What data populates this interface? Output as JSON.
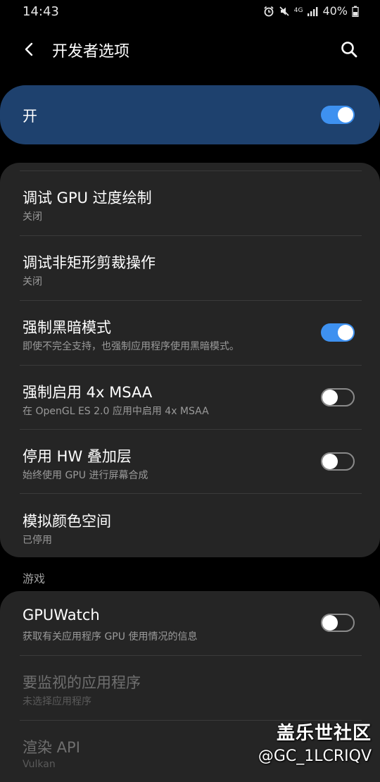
{
  "status_bar": {
    "time": "14:43",
    "network_tag": "4G",
    "battery": "40%"
  },
  "app_bar": {
    "title": "开发者选项",
    "back_icon": "chevron-left-icon",
    "search_icon": "search-icon"
  },
  "master_switch": {
    "label": "开",
    "enabled": true
  },
  "settings": [
    {
      "title": "调试 GPU 过度绘制",
      "subtitle": "关闭",
      "toggle": null,
      "disabled": false
    },
    {
      "title": "调试非矩形剪裁操作",
      "subtitle": "关闭",
      "toggle": null,
      "disabled": false
    },
    {
      "title": "强制黑暗模式",
      "subtitle": "即使不完全支持，也强制应用程序使用黑暗模式。",
      "toggle": true,
      "disabled": false
    },
    {
      "title": "强制启用 4x MSAA",
      "subtitle": "在 OpenGL ES 2.0 应用中启用 4x MSAA",
      "toggle": false,
      "disabled": false
    },
    {
      "title": "停用 HW 叠加层",
      "subtitle": "始终使用 GPU 进行屏幕合成",
      "toggle": false,
      "disabled": false
    },
    {
      "title": "模拟颜色空间",
      "subtitle": "已停用",
      "toggle": null,
      "disabled": false
    }
  ],
  "games_section": {
    "header": "游戏",
    "items": [
      {
        "title": "GPUWatch",
        "subtitle": "获取有关应用程序 GPU 使用情况的信息",
        "toggle": false,
        "disabled": false
      },
      {
        "title": "要监视的应用程序",
        "subtitle": "未选择应用程序",
        "toggle": null,
        "disabled": true
      },
      {
        "title": "渲染 API",
        "subtitle": "Vulkan",
        "toggle": null,
        "disabled": true
      }
    ]
  },
  "watermark": {
    "line1": "盖乐世社区",
    "line2": "@GC_1LCRIQV"
  },
  "colors": {
    "accent": "#3e91f0",
    "master_card": "#1e416e",
    "card": "#252525",
    "background": "#000000"
  }
}
